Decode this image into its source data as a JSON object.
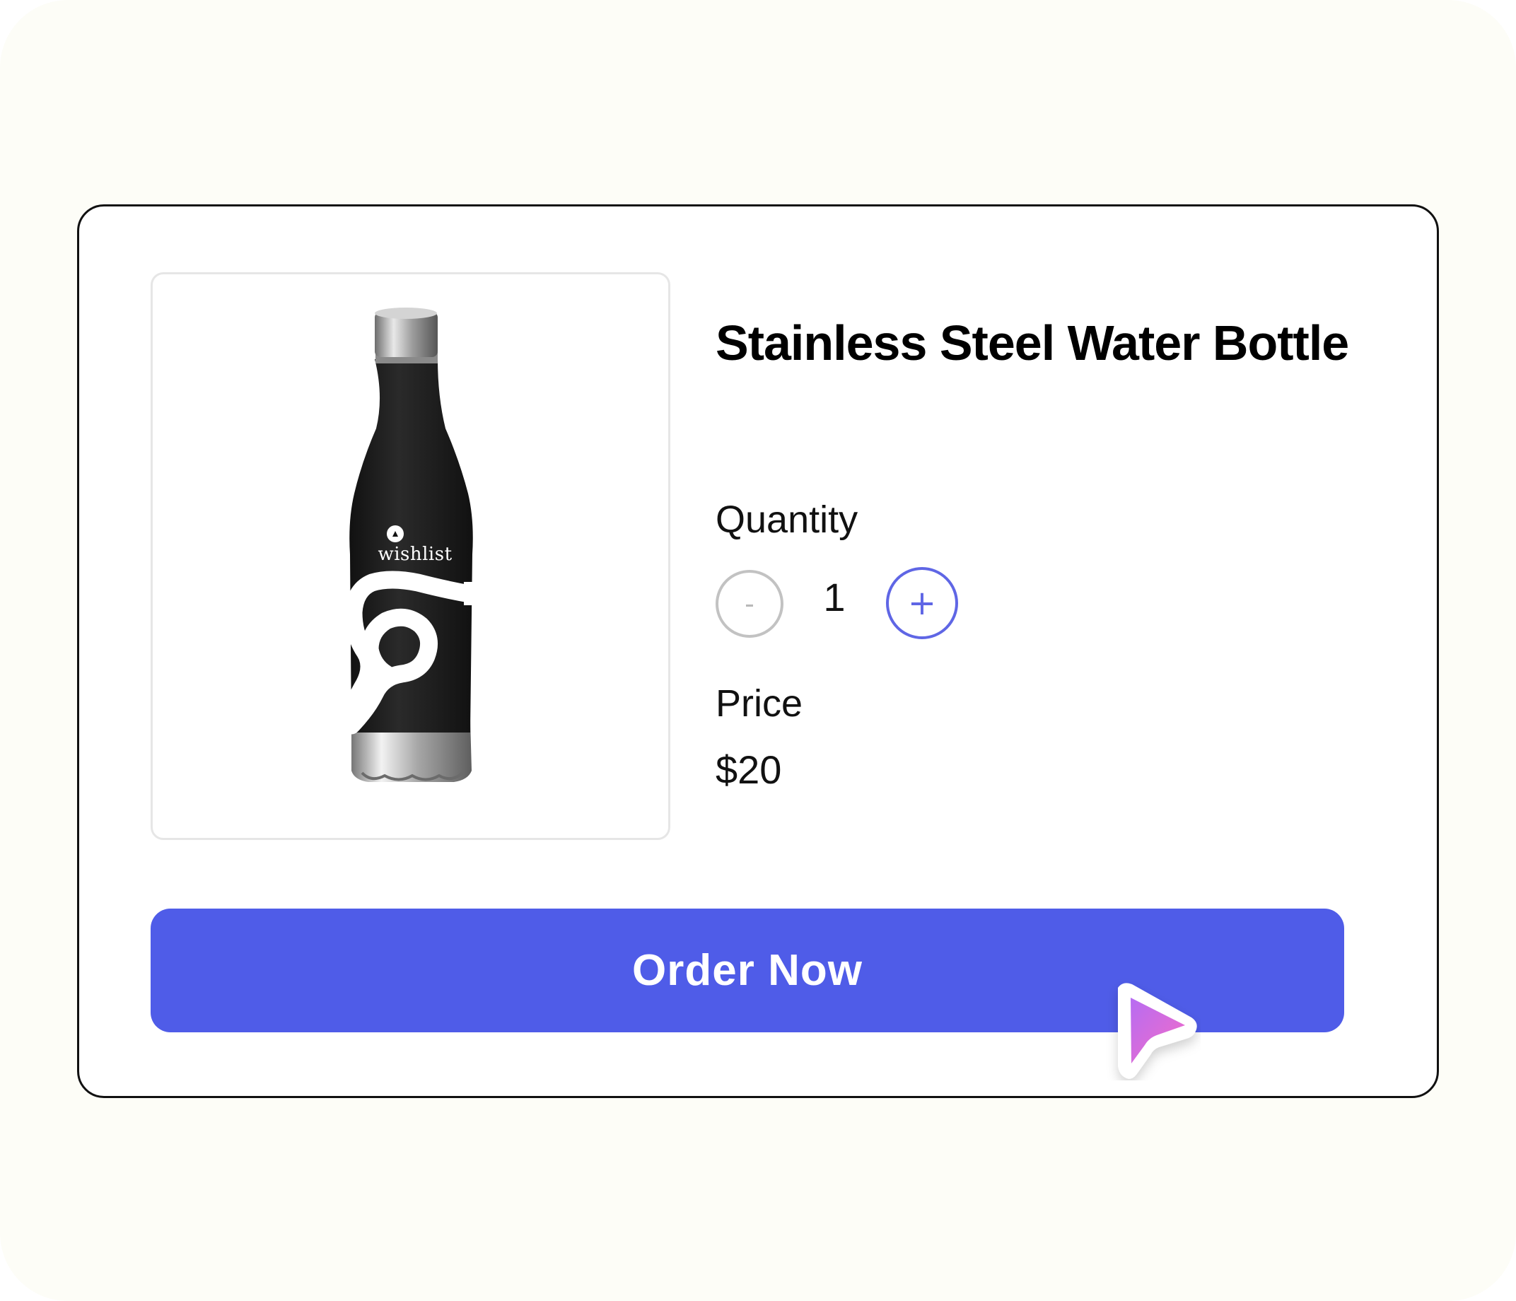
{
  "product": {
    "title": "Stainless Steel Water Bottle",
    "image_brand_text": "wishlist",
    "image_icon": "water-bottle-icon"
  },
  "quantity": {
    "label": "Quantity",
    "value": "1",
    "decrement_label": "-",
    "increment_label": "+",
    "decrement_icon": "minus-icon",
    "increment_icon": "plus-icon"
  },
  "price": {
    "label": "Price",
    "value": "$20"
  },
  "order_button": {
    "label": "Order Now",
    "cursor_icon": "cursor-arrow-icon"
  },
  "colors": {
    "page_background": "#fdfdf7",
    "card_background": "#ffffff",
    "card_border": "#111111",
    "primary": "#4f5ce8",
    "increment_accent": "#5f66e5",
    "disabled_gray": "#c2c2c2",
    "cursor_gradient_start": "#b66cf2",
    "cursor_gradient_end": "#f56bc7"
  }
}
